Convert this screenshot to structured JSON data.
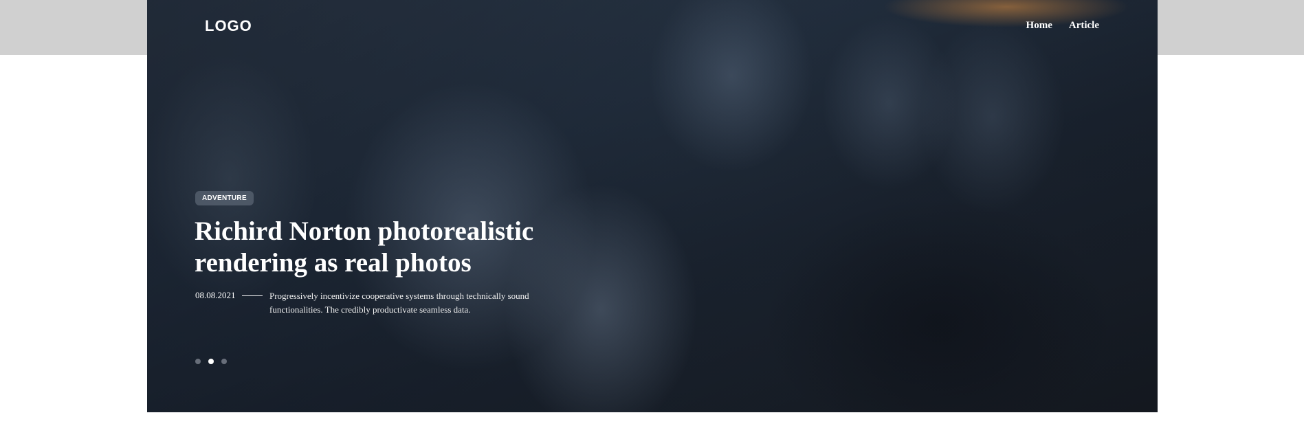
{
  "header": {
    "logo": "LOGO",
    "nav": [
      {
        "label": "Home"
      },
      {
        "label": "Article"
      }
    ]
  },
  "hero": {
    "category": "ADVENTURE",
    "title": "Richird Norton photorealistic rendering as real photos",
    "date": "08.08.2021",
    "description": "Progressively incentivize cooperative systems through technically sound functionalities. The credibly productivate seamless data.",
    "slider": {
      "total": 3,
      "active_index": 1
    }
  }
}
